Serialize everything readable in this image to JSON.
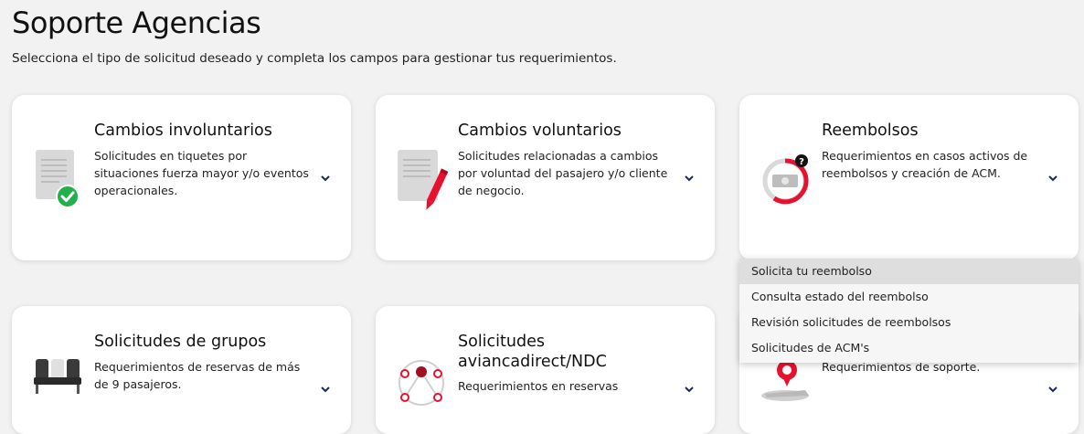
{
  "header": {
    "title": "Soporte Agencias",
    "subtitle": "Selecciona el tipo de solicitud deseado y completa los campos para gestionar tus requerimientos."
  },
  "cards": [
    {
      "title": "Cambios involuntarios",
      "description": "Solicitudes en tiquetes por situaciones fuerza mayor y/o eventos operacionales.",
      "icon": "document-check-icon"
    },
    {
      "title": "Cambios voluntarios",
      "description": "Solicitudes relacionadas a cambios por voluntad del pasajero y/o cliente de negocio.",
      "icon": "document-pencil-icon"
    },
    {
      "title": "Reembolsos",
      "description": "Requerimientos en casos activos de reembolsos y creación de ACM.",
      "icon": "refund-icon"
    },
    {
      "title": "Solicitudes de grupos",
      "description": "Requerimientos de reservas de más de 9 pasajeros.",
      "icon": "seats-icon"
    },
    {
      "title": "Solicitudes aviancadirect/NDC",
      "description": "Requerimientos en reservas",
      "icon": "network-icon"
    },
    {
      "title": "",
      "description": "Requerimientos de soporte.",
      "icon": "airplane-pin-icon"
    }
  ],
  "dropdown": {
    "options": [
      "Solicita tu reembolso",
      "Consulta estado del reembolso",
      "Revisión solicitudes de reembolsos",
      "Solicitudes de ACM's"
    ],
    "active_index": 0
  },
  "colors": {
    "accent": "#e8112d",
    "chevron": "#1b2a55",
    "check": "#22b04b"
  }
}
